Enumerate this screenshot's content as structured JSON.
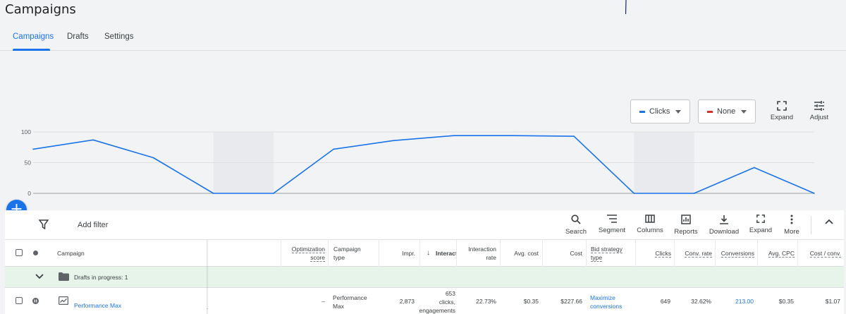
{
  "page": {
    "title": "Campaigns"
  },
  "tabs": [
    {
      "label": "Campaigns",
      "active": true
    },
    {
      "label": "Drafts",
      "active": false
    },
    {
      "label": "Settings",
      "active": false
    }
  ],
  "chart_controls": {
    "metric1": {
      "label": "Clicks",
      "color": "#1a73e8"
    },
    "metric2": {
      "label": "None",
      "color": "#d93025"
    },
    "expand_label": "Expand",
    "adjust_label": "Adjust"
  },
  "chart_data": {
    "type": "line",
    "ylabel": "",
    "ylim": [
      0,
      100
    ],
    "y_ticks": [
      "100",
      "50",
      "0"
    ],
    "series": [
      {
        "color": "#1a73e8",
        "values": [
          72,
          87,
          58,
          0,
          0,
          72,
          86,
          94,
          94,
          93,
          0,
          0,
          42,
          0
        ]
      }
    ],
    "shaded_ranges": [
      [
        3,
        4
      ],
      [
        10,
        11
      ]
    ],
    "grid": true
  },
  "toolbar": {
    "add_filter": "Add filter",
    "buttons": [
      {
        "label": "Search",
        "icon": "search-icon"
      },
      {
        "label": "Segment",
        "icon": "segment-icon"
      },
      {
        "label": "Columns",
        "icon": "columns-icon"
      },
      {
        "label": "Reports",
        "icon": "reports-icon"
      },
      {
        "label": "Download",
        "icon": "download-icon"
      },
      {
        "label": "Expand",
        "icon": "expand-icon"
      },
      {
        "label": "More",
        "icon": "more-vert-icon"
      }
    ]
  },
  "table": {
    "headers": {
      "campaign": "Campaign",
      "opt_score_1": "Optimization",
      "opt_score_2": "score",
      "campaign_type_1": "Campaign",
      "campaign_type_2": "type",
      "impr": "Impr.",
      "interactions": "Interact",
      "interaction_rate_1": "Interaction",
      "interaction_rate_2": "rate",
      "avg_cost": "Avg. cost",
      "cost": "Cost",
      "bid_strategy_1": "Bid strategy",
      "bid_strategy_2": "type",
      "clicks": "Clicks",
      "conv_rate": "Conv. rate",
      "conversions": "Conversions",
      "avg_cpc": "Avg. CPC",
      "cost_conv": "Cost / conv."
    },
    "drafts_row": {
      "label": "Drafts in progress: 1"
    },
    "rows": [
      {
        "campaign": "Performance Max",
        "opt_score": "–",
        "campaign_type_1": "Performance",
        "campaign_type_2": "Max",
        "impr": "2,873",
        "interactions_1": "653",
        "interactions_2": "clicks,",
        "interactions_3": "engagements",
        "interaction_rate": "22.73%",
        "avg_cost": "$0.35",
        "cost": "$227.66",
        "bid_strategy_1": "Maximize",
        "bid_strategy_2": "conversions",
        "clicks": "649",
        "conv_rate": "32.62%",
        "conversions": "213.00",
        "avg_cpc": "$0.35",
        "cost_conv": "$1.07"
      }
    ]
  }
}
